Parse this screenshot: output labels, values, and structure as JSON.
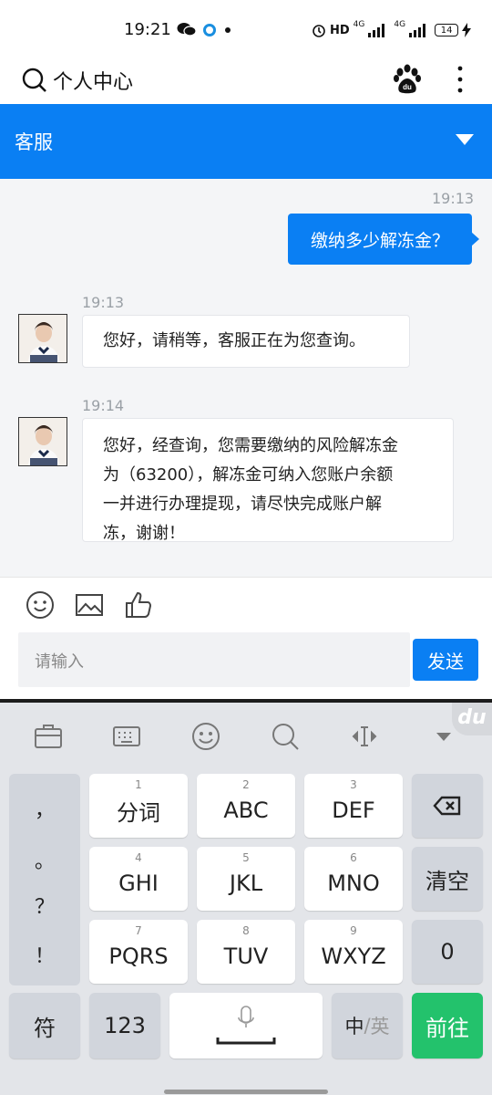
{
  "status_bar": {
    "time": "19:21",
    "hd_label": "HD",
    "net1": "4G",
    "net2": "4G",
    "battery": "14"
  },
  "top_nav": {
    "title": "个人中心"
  },
  "header": {
    "title": "客服"
  },
  "chat": {
    "messages": [
      {
        "timestamp": "19:13",
        "direction": "out",
        "text": "缴纳多少解冻金？"
      },
      {
        "timestamp": "19:13",
        "direction": "in",
        "text": "您好，请稍等，客服正在为您查询。"
      },
      {
        "timestamp": "19:14",
        "direction": "in",
        "lines": [
          "您好，经查询，您需要缴纳的风险解冻金",
          "为（63200），解冻金可纳入您账户余额",
          "一并进行办理提现，请尽快完成账户解",
          "冻，谢谢！"
        ]
      }
    ]
  },
  "composer": {
    "placeholder": "请输入",
    "send_label": "发送"
  },
  "keyboard": {
    "logo": "du",
    "punctuation": [
      "，",
      "。",
      "？",
      "！"
    ],
    "keys": [
      {
        "num": "1",
        "label": "分词"
      },
      {
        "num": "2",
        "label": "ABC"
      },
      {
        "num": "3",
        "label": "DEF"
      },
      {
        "num": "4",
        "label": "GHI"
      },
      {
        "num": "5",
        "label": "JKL"
      },
      {
        "num": "6",
        "label": "MNO"
      },
      {
        "num": "7",
        "label": "PQRS"
      },
      {
        "num": "8",
        "label": "TUV"
      },
      {
        "num": "9",
        "label": "WXYZ"
      }
    ],
    "clear_label": "清空",
    "zero_label": "0",
    "symbol_label": "符",
    "numbers_label": "123",
    "lang_cn": "中",
    "lang_sep": "/",
    "lang_en": "英",
    "go_label": "前往"
  },
  "colors": {
    "accent": "#0a7ff3",
    "go": "#23c26c"
  }
}
